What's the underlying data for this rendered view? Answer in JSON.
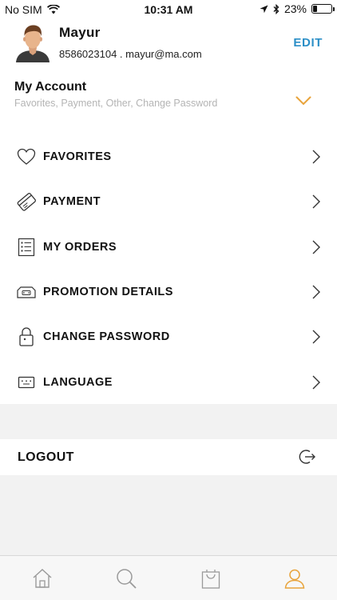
{
  "status_bar": {
    "carrier": "No SIM",
    "time": "10:31 AM",
    "battery": "23%",
    "battery_level": 0.23
  },
  "profile": {
    "name": "Mayur",
    "contact": "8586023104 . mayur@ma.com",
    "edit_label": "EDIT"
  },
  "account": {
    "title": "My Account",
    "subtitle": "Favorites, Payment, Other, Change Password"
  },
  "menu": [
    {
      "label": "FAVORITES",
      "icon": "heart-icon"
    },
    {
      "label": "PAYMENT",
      "icon": "credit-card-icon"
    },
    {
      "label": "MY ORDERS",
      "icon": "list-icon"
    },
    {
      "label": "PROMOTION DETAILS",
      "icon": "ticket-icon"
    },
    {
      "label": "CHANGE PASSWORD",
      "icon": "lock-icon"
    },
    {
      "label": "LANGUAGE",
      "icon": "keyboard-icon"
    }
  ],
  "logout": {
    "label": "LOGOUT",
    "icon": "logout-icon"
  },
  "tabbar": {
    "active": "profile",
    "accent": "#e8a33a",
    "items": [
      "home-icon",
      "search-icon",
      "bag-icon",
      "profile-icon"
    ]
  },
  "colors": {
    "edit": "#2c8fc7",
    "chevron": "#e8a33a"
  }
}
